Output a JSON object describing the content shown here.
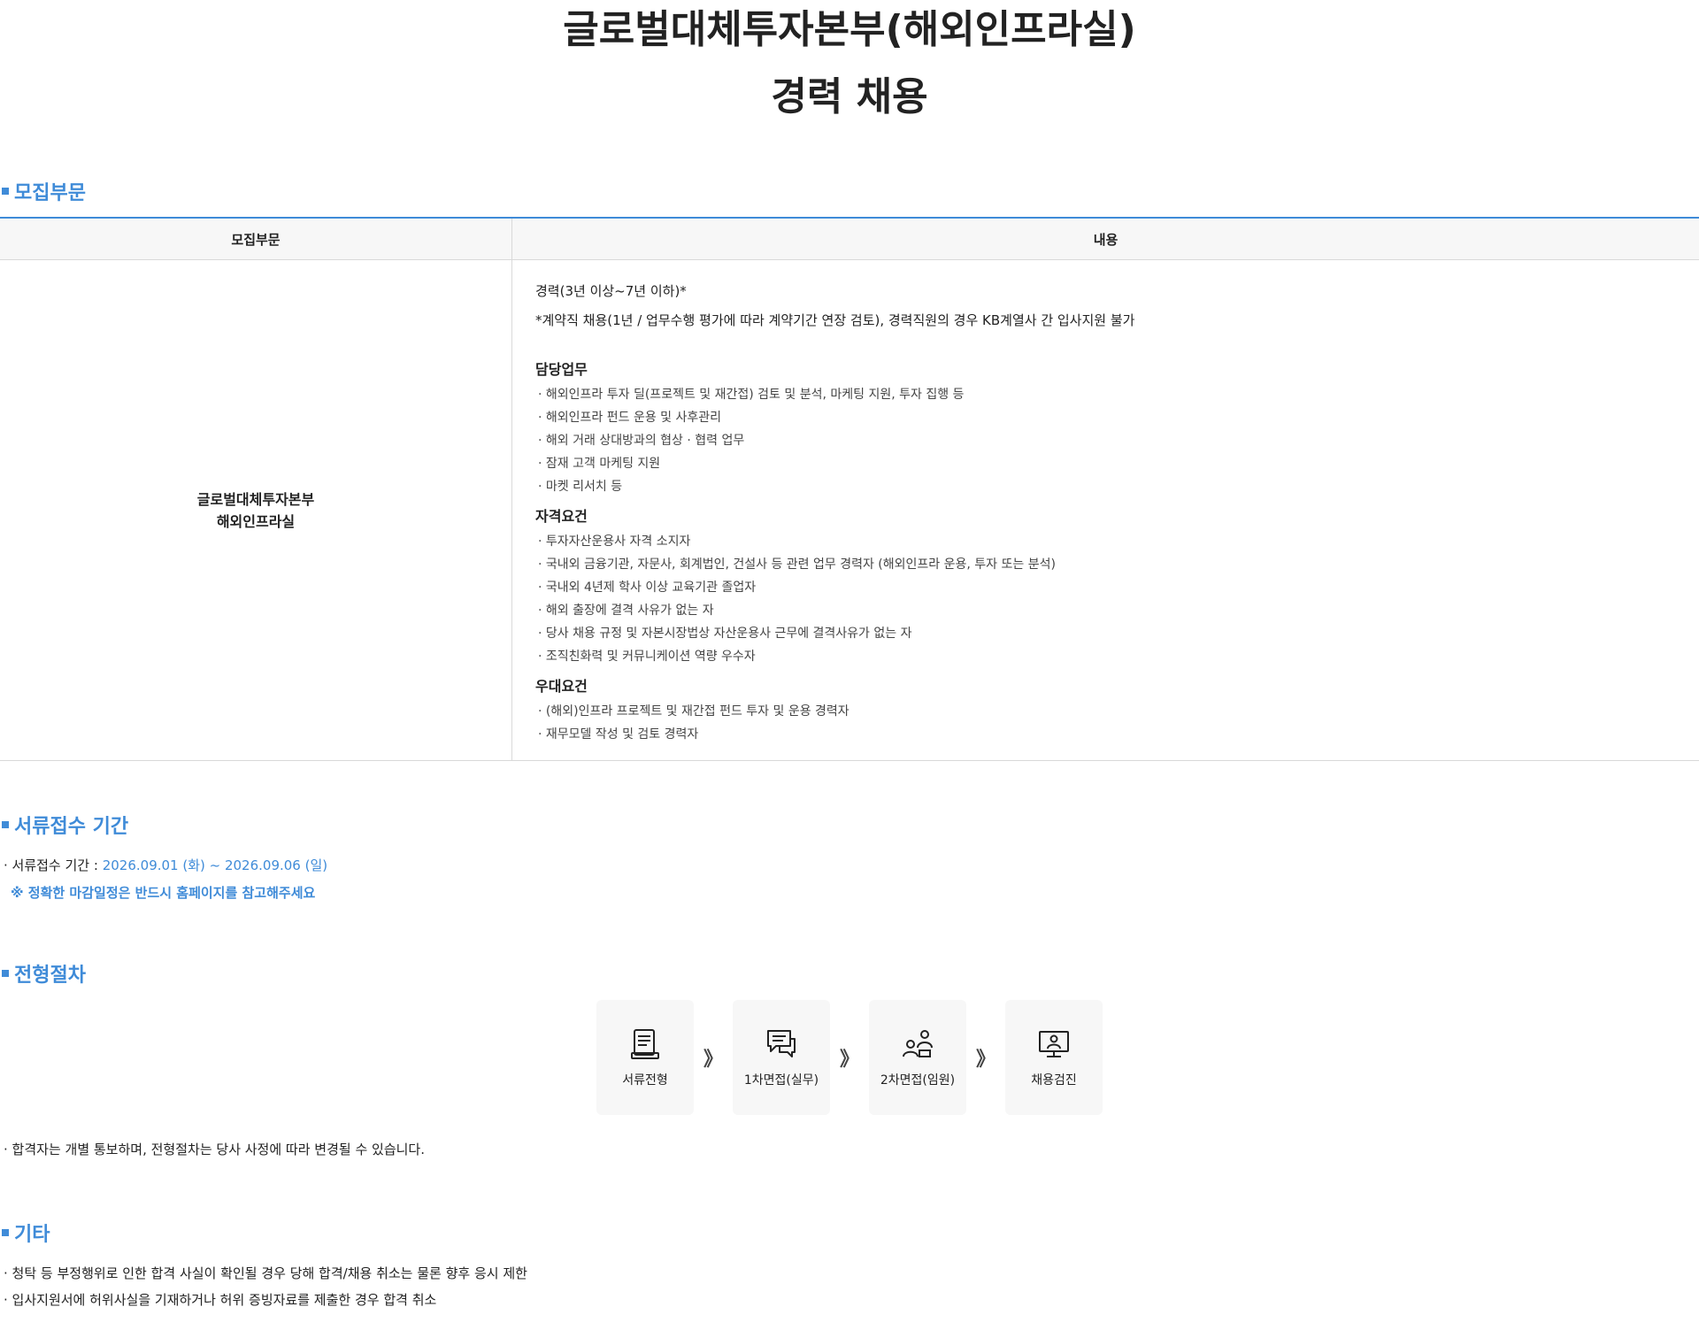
{
  "header": {
    "title_line1": "글로벌대체투자본부(해외인프라실)",
    "title_line2": "경력 채용"
  },
  "recruit": {
    "heading": "모집부문",
    "col_header_1": "모집부문",
    "col_header_2": "내용",
    "dept_line1": "글로벌대체투자본부",
    "dept_line2": "해외인프라실",
    "career": "경력(3년 이상~7년 이하)*",
    "contract_note": "*계약직 채용(1년 / 업무수행 평가에 따라 계약기간 연장 검토), 경력직원의 경우 KB계열사 간 입사지원 불가",
    "duties_title": "담당업무",
    "duties": [
      "해외인프라 투자 딜(프로젝트 및 재간접) 검토 및 분석, 마케팅 지원, 투자 집행 등",
      "해외인프라 펀드 운용 및 사후관리",
      "해외 거래 상대방과의 협상 · 협력 업무",
      "잠재 고객 마케팅 지원",
      "마켓 리서치 등"
    ],
    "qual_title": "자격요건",
    "quals": [
      "투자자산운용사 자격 소지자",
      "국내외 금융기관, 자문사, 회계법인, 건설사 등 관련 업무 경력자 (해외인프라 운용, 투자 또는 분석)",
      "국내외 4년제 학사 이상 교육기관 졸업자",
      "해외 출장에 결격 사유가 없는 자",
      "당사 채용 규정 및 자본시장법상 자산운용사 근무에 결격사유가 없는 자",
      "조직친화력 및 커뮤니케이션 역량 우수자"
    ],
    "pref_title": "우대요건",
    "prefs": [
      "(해외)인프라 프로젝트 및 재간접 펀드 투자 및 운용 경력자",
      "재무모델 작성 및 검토 경력자"
    ]
  },
  "period": {
    "heading": "서류접수 기간",
    "label": "· 서류접수 기간 : ",
    "date": "2026.09.01 (화) ~ 2026.09.06 (일)",
    "note": "※ 정확한 마감일정은 반드시 홈페이지를 참고해주세요"
  },
  "process": {
    "heading": "전형절차",
    "steps": [
      {
        "label": "서류전형",
        "icon": "document-icon"
      },
      {
        "label": "1차면접(실무)",
        "icon": "chat-icon"
      },
      {
        "label": "2차면접(임원)",
        "icon": "people-icon"
      },
      {
        "label": "채용검진",
        "icon": "monitor-person-icon"
      }
    ],
    "arrow": "》",
    "note": "합격자는 개별 통보하며, 전형절차는 당사 사정에 따라 변경될 수 있습니다."
  },
  "etc": {
    "heading": "기타",
    "items": [
      "청탁 등 부정행위로 인한 합격 사실이 확인될 경우 당해 합격/채용 취소는 물론 향후 응시 제한",
      "입사지원서에 허위사실을 기재하거나 허위 증빙자료를 제출한 경우 합격 취소"
    ]
  },
  "colors": {
    "accent": "#3f8bd8",
    "header_bg": "#f7f7f7",
    "step_bg": "#f7f7f7"
  }
}
